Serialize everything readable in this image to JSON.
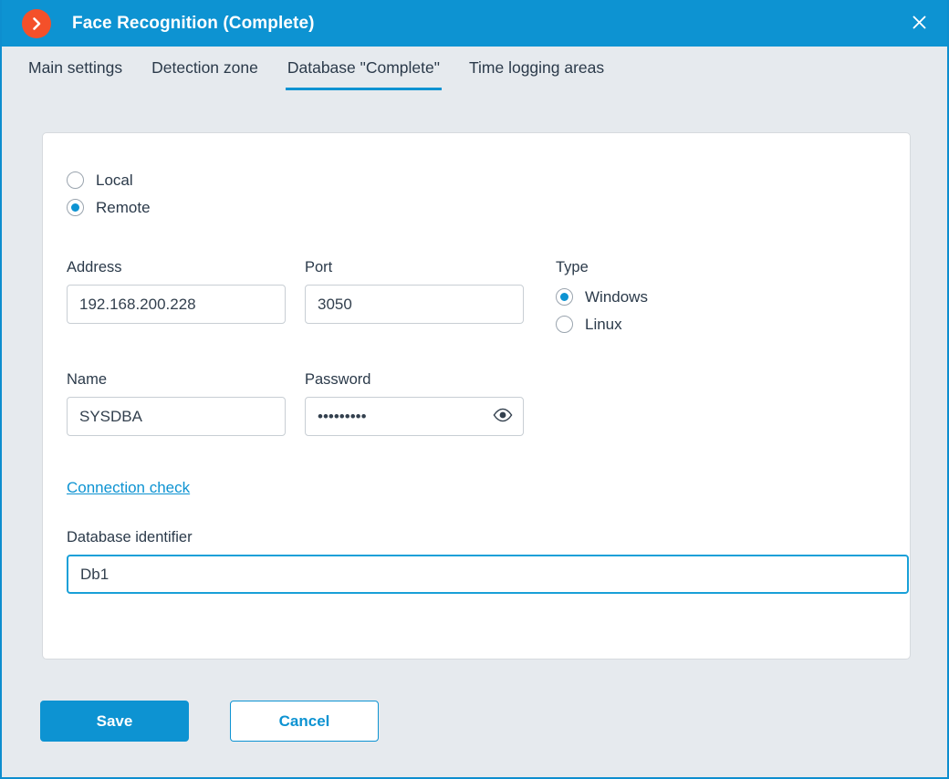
{
  "window": {
    "title": "Face Recognition (Complete)",
    "logo_icon": "chevron-right-circle-icon",
    "close_icon": "close-icon",
    "accent_color": "#0d93d2",
    "logo_color": "#f4502a",
    "page_background": "#e6eaee"
  },
  "tabs": [
    {
      "label": "Main settings",
      "active": false
    },
    {
      "label": "Detection zone",
      "active": false
    },
    {
      "label": "Database \"Complete\"",
      "active": true
    },
    {
      "label": "Time logging areas",
      "active": false
    }
  ],
  "form": {
    "location": {
      "options": [
        {
          "label": "Local",
          "selected": false
        },
        {
          "label": "Remote",
          "selected": true
        }
      ]
    },
    "address": {
      "label": "Address",
      "value": "192.168.200.228",
      "placeholder": ""
    },
    "port": {
      "label": "Port",
      "value": "3050",
      "placeholder": ""
    },
    "type": {
      "label": "Type",
      "options": [
        {
          "label": "Windows",
          "selected": true
        },
        {
          "label": "Linux",
          "selected": false
        }
      ]
    },
    "name": {
      "label": "Name",
      "value": "SYSDBA",
      "placeholder": ""
    },
    "password": {
      "label": "Password",
      "value": "•••••••••",
      "masked_char_count": 9,
      "placeholder": "",
      "toggle_icon": "eye-icon"
    },
    "connection_check": {
      "label": "Connection check"
    },
    "database_identifier": {
      "label": "Database identifier",
      "value": "Db1",
      "placeholder": "",
      "focused": true
    }
  },
  "footer": {
    "save_label": "Save",
    "cancel_label": "Cancel"
  }
}
